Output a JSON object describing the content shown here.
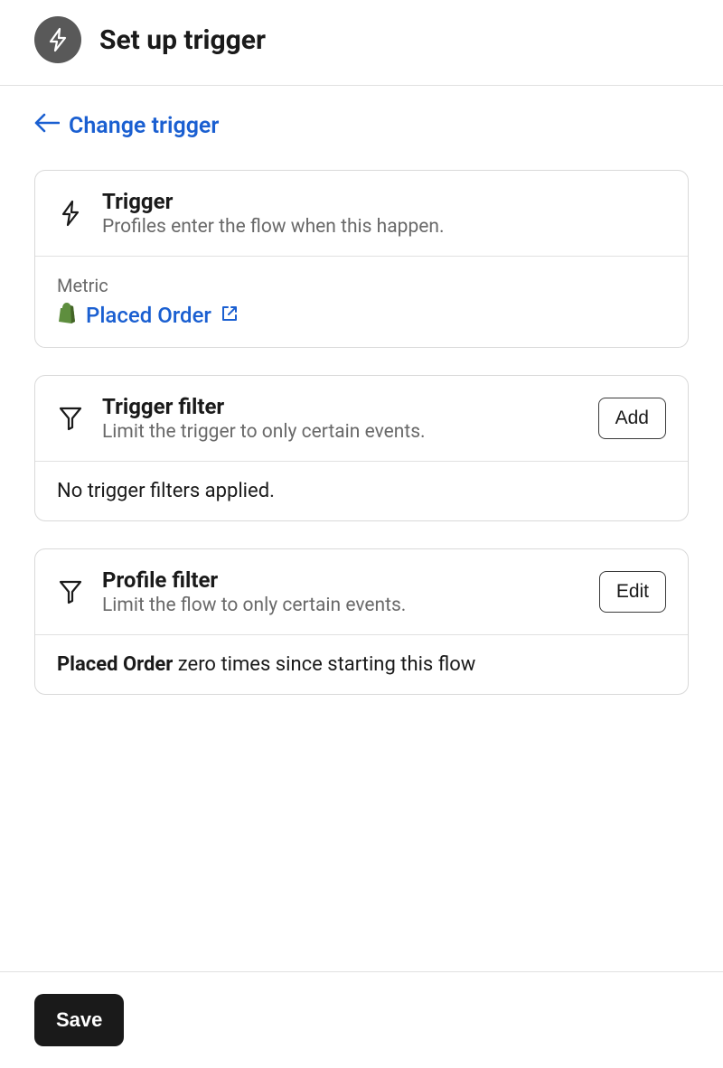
{
  "header": {
    "title": "Set up trigger"
  },
  "change_trigger_label": "Change trigger",
  "trigger_card": {
    "title": "Trigger",
    "subtitle": "Profiles enter the flow when this happen.",
    "metric_label": "Metric",
    "metric_value": "Placed Order"
  },
  "trigger_filter_card": {
    "title": "Trigger filter",
    "subtitle": "Limit the trigger to only certain events.",
    "button_label": "Add",
    "body_text": "No trigger filters applied."
  },
  "profile_filter_card": {
    "title": "Profile filter",
    "subtitle": "Limit the flow to only certain events.",
    "button_label": "Edit",
    "body_bold": "Placed Order",
    "body_rest": " zero times since starting this flow"
  },
  "footer": {
    "save_label": "Save"
  }
}
